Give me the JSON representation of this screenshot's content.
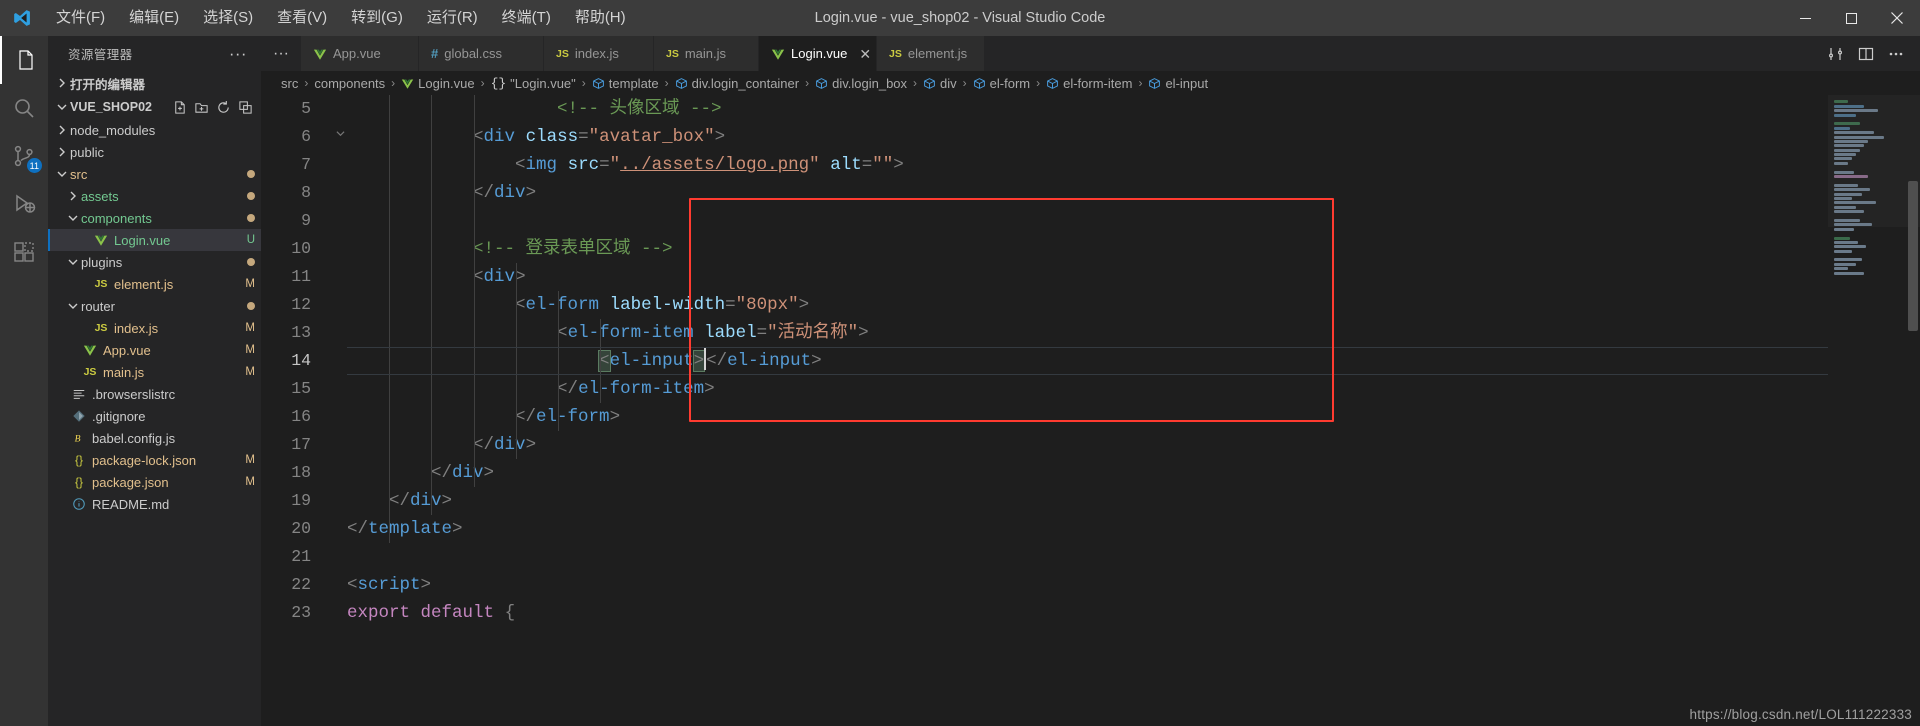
{
  "window": {
    "title": "Login.vue - vue_shop02 - Visual Studio Code",
    "menu": [
      "文件(F)",
      "编辑(E)",
      "选择(S)",
      "查看(V)",
      "转到(G)",
      "运行(R)",
      "终端(T)",
      "帮助(H)"
    ],
    "controls": {
      "minimize": "minimize-icon",
      "maximize": "maximize-icon",
      "close": "close-icon"
    }
  },
  "activitybar": {
    "items": [
      {
        "name": "explorer",
        "icon": "files-icon",
        "active": true,
        "badge": ""
      },
      {
        "name": "search",
        "icon": "search-icon",
        "active": false,
        "badge": ""
      },
      {
        "name": "source-control",
        "icon": "source-control-icon",
        "active": false,
        "badge": "11"
      },
      {
        "name": "run-and-debug",
        "icon": "debug-icon",
        "active": false,
        "badge": ""
      },
      {
        "name": "extensions",
        "icon": "extensions-icon",
        "active": false,
        "badge": ""
      }
    ]
  },
  "sidebar": {
    "title": "资源管理器",
    "more_label": "···",
    "open_editors_label": "打开的编辑器",
    "root_label": "VUE_SHOP02",
    "root_actions": [
      "new-file-icon",
      "new-folder-icon",
      "refresh-icon",
      "collapse-all-icon"
    ],
    "tree": [
      {
        "label": "node_modules",
        "type": "folder",
        "expanded": false,
        "depth": 1,
        "color": "grey",
        "status": ""
      },
      {
        "label": "public",
        "type": "folder",
        "expanded": false,
        "depth": 1,
        "color": "grey",
        "status": ""
      },
      {
        "label": "src",
        "type": "folder",
        "expanded": true,
        "depth": 1,
        "color": "yellow",
        "status": "dot"
      },
      {
        "label": "assets",
        "type": "folder",
        "expanded": false,
        "depth": 2,
        "color": "green",
        "status": "dot"
      },
      {
        "label": "components",
        "type": "folder",
        "expanded": true,
        "depth": 2,
        "color": "green",
        "status": "dot"
      },
      {
        "label": "Login.vue",
        "type": "vue",
        "depth": 3,
        "color": "green",
        "status": "U",
        "selected": true
      },
      {
        "label": "plugins",
        "type": "folder",
        "expanded": true,
        "depth": 2,
        "color": "grey",
        "status": "dot"
      },
      {
        "label": "element.js",
        "type": "js",
        "depth": 3,
        "color": "yellow",
        "status": "M"
      },
      {
        "label": "router",
        "type": "folder",
        "expanded": true,
        "depth": 2,
        "color": "grey",
        "status": "dot"
      },
      {
        "label": "index.js",
        "type": "js",
        "depth": 3,
        "color": "yellow",
        "status": "M"
      },
      {
        "label": "App.vue",
        "type": "vue",
        "depth": 2,
        "color": "yellow",
        "status": "M"
      },
      {
        "label": "main.js",
        "type": "js",
        "depth": 2,
        "color": "yellow",
        "status": "M"
      },
      {
        "label": ".browserslistrc",
        "type": "list",
        "depth": 1,
        "color": "grey",
        "status": ""
      },
      {
        "label": ".gitignore",
        "type": "git",
        "depth": 1,
        "color": "grey",
        "status": ""
      },
      {
        "label": "babel.config.js",
        "type": "babel",
        "depth": 1,
        "color": "grey",
        "status": ""
      },
      {
        "label": "package-lock.json",
        "type": "json",
        "depth": 1,
        "color": "yellow",
        "status": "M"
      },
      {
        "label": "package.json",
        "type": "json",
        "depth": 1,
        "color": "yellow",
        "status": "M"
      },
      {
        "label": "README.md",
        "type": "md",
        "depth": 1,
        "color": "grey",
        "status": ""
      }
    ]
  },
  "tabs": {
    "overflow_label": "···",
    "items": [
      {
        "label": "App.vue",
        "icon": "vue-icon",
        "active": false,
        "closable": false
      },
      {
        "label": "global.css",
        "icon": "css-icon",
        "active": false,
        "closable": false
      },
      {
        "label": "index.js",
        "icon": "js-icon",
        "active": false,
        "closable": false
      },
      {
        "label": "main.js",
        "icon": "js-icon",
        "active": false,
        "closable": false
      },
      {
        "label": "Login.vue",
        "icon": "vue-icon",
        "active": true,
        "closable": true
      },
      {
        "label": "element.js",
        "icon": "js-icon",
        "active": false,
        "closable": false
      }
    ],
    "actions": [
      "split-diff-icon",
      "split-editor-icon",
      "more-actions-icon"
    ]
  },
  "breadcrumbs": [
    {
      "label": "src",
      "icon": ""
    },
    {
      "label": "components",
      "icon": ""
    },
    {
      "label": "Login.vue",
      "icon": "vue-icon"
    },
    {
      "label": "\"Login.vue\"",
      "icon": "braces-icon"
    },
    {
      "label": "template",
      "icon": "symbol-cube-icon"
    },
    {
      "label": "div.login_container",
      "icon": "symbol-cube-icon"
    },
    {
      "label": "div.login_box",
      "icon": "symbol-cube-icon"
    },
    {
      "label": "div",
      "icon": "symbol-cube-icon"
    },
    {
      "label": "el-form",
      "icon": "symbol-cube-icon"
    },
    {
      "label": "el-form-item",
      "icon": "symbol-cube-icon"
    },
    {
      "label": "el-input",
      "icon": "symbol-cube-icon"
    }
  ],
  "editor": {
    "first_visible_line": 5,
    "current_line": 14,
    "lines": [
      {
        "no": 5,
        "tokens": [
          {
            "t": "cmt",
            "s": "                    <!-- 头像区域 -->"
          }
        ],
        "clipped": true
      },
      {
        "no": 6,
        "tokens": [
          {
            "t": "plain",
            "s": "            "
          },
          {
            "t": "brk",
            "s": "<"
          },
          {
            "t": "tag",
            "s": "div"
          },
          {
            "t": "plain",
            "s": " "
          },
          {
            "t": "attr",
            "s": "class"
          },
          {
            "t": "brk",
            "s": "="
          },
          {
            "t": "str",
            "s": "\"avatar_box\""
          },
          {
            "t": "brk",
            "s": ">"
          }
        ]
      },
      {
        "no": 7,
        "tokens": [
          {
            "t": "plain",
            "s": "                "
          },
          {
            "t": "brk",
            "s": "<"
          },
          {
            "t": "tag",
            "s": "img"
          },
          {
            "t": "plain",
            "s": " "
          },
          {
            "t": "attr",
            "s": "src"
          },
          {
            "t": "brk",
            "s": "="
          },
          {
            "t": "str",
            "s": "\""
          },
          {
            "t": "link",
            "s": "../assets/logo.png"
          },
          {
            "t": "str",
            "s": "\""
          },
          {
            "t": "plain",
            "s": " "
          },
          {
            "t": "attr",
            "s": "alt"
          },
          {
            "t": "brk",
            "s": "="
          },
          {
            "t": "str",
            "s": "\"\""
          },
          {
            "t": "brk",
            "s": ">"
          }
        ]
      },
      {
        "no": 8,
        "tokens": [
          {
            "t": "plain",
            "s": "            "
          },
          {
            "t": "brk",
            "s": "</"
          },
          {
            "t": "tag",
            "s": "div"
          },
          {
            "t": "brk",
            "s": ">"
          }
        ]
      },
      {
        "no": 9,
        "tokens": [
          {
            "t": "plain",
            "s": ""
          }
        ]
      },
      {
        "no": 10,
        "tokens": [
          {
            "t": "plain",
            "s": "            "
          },
          {
            "t": "cmt",
            "s": "<!-- 登录表单区域 -->"
          }
        ]
      },
      {
        "no": 11,
        "tokens": [
          {
            "t": "plain",
            "s": "            "
          },
          {
            "t": "brk",
            "s": "<"
          },
          {
            "t": "tag",
            "s": "div"
          },
          {
            "t": "brk",
            "s": ">"
          }
        ]
      },
      {
        "no": 12,
        "tokens": [
          {
            "t": "plain",
            "s": "                "
          },
          {
            "t": "brk",
            "s": "<"
          },
          {
            "t": "tag",
            "s": "el-form"
          },
          {
            "t": "plain",
            "s": " "
          },
          {
            "t": "attr",
            "s": "label-width"
          },
          {
            "t": "brk",
            "s": "="
          },
          {
            "t": "str",
            "s": "\"80px\""
          },
          {
            "t": "brk",
            "s": ">"
          }
        ]
      },
      {
        "no": 13,
        "tokens": [
          {
            "t": "plain",
            "s": "                    "
          },
          {
            "t": "brk",
            "s": "<"
          },
          {
            "t": "tag",
            "s": "el-form-item"
          },
          {
            "t": "plain",
            "s": " "
          },
          {
            "t": "attr",
            "s": "label"
          },
          {
            "t": "brk",
            "s": "="
          },
          {
            "t": "str",
            "s": "\"活动名称\""
          },
          {
            "t": "brk",
            "s": ">"
          }
        ]
      },
      {
        "no": 14,
        "tokens": [
          {
            "t": "plain",
            "s": "                        "
          },
          {
            "t": "hl",
            "s": "<"
          },
          {
            "t": "tag",
            "s": "el-input"
          },
          {
            "t": "hl",
            "s": ">"
          },
          {
            "t": "cursor",
            "s": ""
          },
          {
            "t": "brk",
            "s": "</"
          },
          {
            "t": "tag",
            "s": "el-input"
          },
          {
            "t": "brk",
            "s": ">"
          }
        ],
        "current": true
      },
      {
        "no": 15,
        "tokens": [
          {
            "t": "plain",
            "s": "                    "
          },
          {
            "t": "brk",
            "s": "</"
          },
          {
            "t": "tag",
            "s": "el-form-item"
          },
          {
            "t": "brk",
            "s": ">"
          }
        ]
      },
      {
        "no": 16,
        "tokens": [
          {
            "t": "plain",
            "s": "                "
          },
          {
            "t": "brk",
            "s": "</"
          },
          {
            "t": "tag",
            "s": "el-form"
          },
          {
            "t": "brk",
            "s": ">"
          }
        ]
      },
      {
        "no": 17,
        "tokens": [
          {
            "t": "plain",
            "s": "            "
          },
          {
            "t": "brk",
            "s": "</"
          },
          {
            "t": "tag",
            "s": "div"
          },
          {
            "t": "brk",
            "s": ">"
          }
        ]
      },
      {
        "no": 18,
        "tokens": [
          {
            "t": "plain",
            "s": "        "
          },
          {
            "t": "brk",
            "s": "</"
          },
          {
            "t": "tag",
            "s": "div"
          },
          {
            "t": "brk",
            "s": ">"
          }
        ]
      },
      {
        "no": 19,
        "tokens": [
          {
            "t": "plain",
            "s": "    "
          },
          {
            "t": "brk",
            "s": "</"
          },
          {
            "t": "tag",
            "s": "div"
          },
          {
            "t": "brk",
            "s": ">"
          }
        ]
      },
      {
        "no": 20,
        "tokens": [
          {
            "t": "brk",
            "s": "</"
          },
          {
            "t": "tag",
            "s": "template"
          },
          {
            "t": "brk",
            "s": ">"
          }
        ]
      },
      {
        "no": 21,
        "tokens": [
          {
            "t": "plain",
            "s": ""
          }
        ]
      },
      {
        "no": 22,
        "tokens": [
          {
            "t": "brk",
            "s": "<"
          },
          {
            "t": "tag",
            "s": "script"
          },
          {
            "t": "brk",
            "s": ">"
          }
        ]
      },
      {
        "no": 23,
        "tokens": [
          {
            "t": "kw",
            "s": "export"
          },
          {
            "t": "plain",
            "s": " "
          },
          {
            "t": "kw",
            "s": "default"
          },
          {
            "t": "plain",
            "s": " "
          },
          {
            "t": "brk",
            "s": "{"
          }
        ],
        "clipped": true
      }
    ],
    "annotation": {
      "name": "red-highlight-box",
      "color": "#ff3b30"
    }
  },
  "watermark": "https://blog.csdn.net/LOL111222333",
  "colors": {
    "accent": "#0e70c0",
    "titlebar": "#3c3c3c",
    "sidebar": "#252526",
    "editor": "#1e1e1e",
    "activitybar": "#333333",
    "annotation": "#ff3b30"
  }
}
